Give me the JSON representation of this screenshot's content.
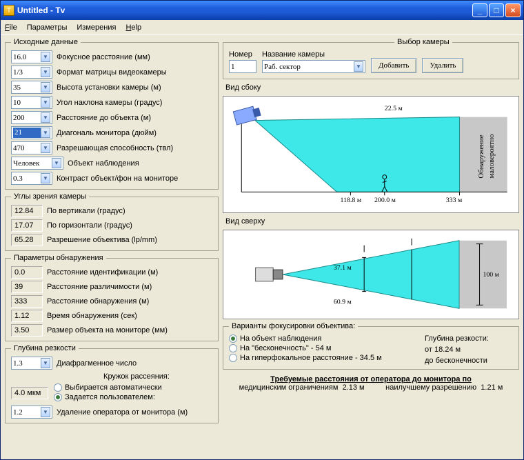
{
  "window": {
    "title": "Untitled - Tv"
  },
  "menu": {
    "file": "File",
    "params": "Параметры",
    "measure": "Измерения",
    "help": "Help"
  },
  "groups": {
    "source": "Исходные данные",
    "angles": "Углы зрения камеры",
    "detect": "Параметры обнаружения",
    "depth": "Глубина резкости",
    "camsel": "Выбор камеры",
    "focus": "Варианты фокусировки объектива:"
  },
  "source": {
    "focal": {
      "val": "16.0",
      "lbl": "Фокусное расстояние (мм)"
    },
    "matrix": {
      "val": "1/3",
      "lbl": "Формат матрицы видеокамеры"
    },
    "height": {
      "val": "35",
      "lbl": "Высота установки камеры (м)"
    },
    "tilt": {
      "val": "10",
      "lbl": "Угол наклона камеры (градус)"
    },
    "dist": {
      "val": "200",
      "lbl": "Расстояние до объекта (м)"
    },
    "diag": {
      "val": "21",
      "lbl": "Диагональ монитора (дюйм)"
    },
    "tvl": {
      "val": "470",
      "lbl": "Разрешающая способность (твл)"
    },
    "obj": {
      "val": "Человек",
      "lbl": "Объект наблюдения"
    },
    "contrast": {
      "val": "0.3",
      "lbl": "Контраст объект/фон на мониторе"
    }
  },
  "angles": {
    "vert": {
      "val": "12.84",
      "lbl": "По вертикали (градус)"
    },
    "horiz": {
      "val": "17.07",
      "lbl": "По горизонтали (градус)"
    },
    "lpmm": {
      "val": "65.28",
      "lbl": "Разрешение объектива (lp/mm)"
    }
  },
  "detect": {
    "ident": {
      "val": "0.0",
      "lbl": "Расстояние идентификации (м)"
    },
    "disc": {
      "val": "39",
      "lbl": "Расстояние различимости (м)"
    },
    "det": {
      "val": "333",
      "lbl": "Расстояние обнаружения (м)"
    },
    "time": {
      "val": "1.12",
      "lbl": "Время обнаружения (сек)"
    },
    "size": {
      "val": "3.50",
      "lbl": "Размер объекта на мониторе (мм)"
    }
  },
  "depth": {
    "fnum": {
      "val": "1.3",
      "lbl": "Диафрагменное число"
    },
    "circle_title": "Кружок рассеяния:",
    "auto": {
      "lbl": "Выбирается автоматически"
    },
    "user": {
      "lbl": "Задается пользователем:"
    },
    "mkm": {
      "val": "4.0 мкм"
    },
    "opdist": {
      "val": "1.2",
      "lbl": "Удаление оператора от монитора (м)"
    }
  },
  "camsel": {
    "num_lbl": "Номер",
    "name_lbl": "Название камеры",
    "num": "1",
    "name": "Раб. сектор",
    "add": "Добавить",
    "del": "Удалить"
  },
  "diagrams": {
    "side_title": "Вид сбоку",
    "top_title": "Вид сверху",
    "side": {
      "top": "22.5 м",
      "x1": "118.8 м",
      "x2": "200.0 м",
      "x3": "333 м",
      "gray": "Обнаружение\nмаловероятно"
    },
    "top": {
      "w1": "37.1 м",
      "w2": "60.9 м",
      "h": "100 м"
    }
  },
  "focus": {
    "opt1": "На объект наблюдения",
    "opt2": "На \"бесконечность\" -  54 м",
    "opt3": "На гиперфокальное расстояние -  34.5 м",
    "dof_lbl": "Глубина резкости:",
    "from": "от   18.24 м",
    "to": "до   бесконечности"
  },
  "bottom": {
    "title": "Требуемые расстояния от оператора до монитора по",
    "med_lbl": "медицинским ограничениям",
    "med": "2.13 м",
    "best_lbl": "наилучшему разрешению",
    "best": "1.21 м"
  }
}
